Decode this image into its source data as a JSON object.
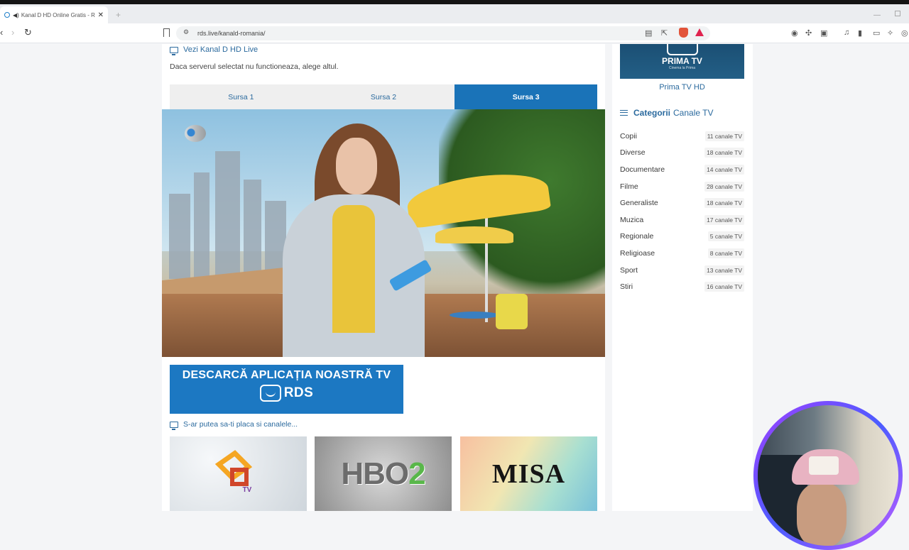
{
  "browser": {
    "tab_title": "Kanal D HD Online Gratis - RDS",
    "url": "rds.live/kanald-romania/",
    "new_tab_symbol": "+",
    "close_symbol": "✕"
  },
  "main": {
    "live_title": "Vezi Kanal D HD Live",
    "notice": "Daca serverul selectat nu functioneaza, alege altul.",
    "sources": [
      "Sursa 1",
      "Sursa 2",
      "Sursa 3"
    ],
    "active_source_index": 2,
    "app_banner": {
      "line1": "DESCARCĂ APLICAȚIA NOASTRĂ TV",
      "brand": "RDS"
    },
    "suggest_title": "S-ar putea sa-ti placa si canalele...",
    "suggested_channels": [
      {
        "name": "UTV",
        "logo_text": "TV"
      },
      {
        "name": "HBO 2",
        "logo_text_a": "HBO",
        "logo_text_b": "2"
      },
      {
        "name": "MISA",
        "logo_text": "MISA"
      }
    ]
  },
  "sidebar": {
    "featured": {
      "logo_name": "PRIMA TV",
      "logo_sub": "Cinema la Prima",
      "caption": "Prima TV HD"
    },
    "categories_title_pre": "Categorii",
    "categories_title": "Canale TV",
    "categories": [
      {
        "name": "Copii",
        "count": "11 canale TV"
      },
      {
        "name": "Diverse",
        "count": "18 canale TV"
      },
      {
        "name": "Documentare",
        "count": "14 canale TV"
      },
      {
        "name": "Filme",
        "count": "28 canale TV"
      },
      {
        "name": "Generaliste",
        "count": "18 canale TV"
      },
      {
        "name": "Muzica",
        "count": "17 canale TV"
      },
      {
        "name": "Regionale",
        "count": "5 canale TV"
      },
      {
        "name": "Religioase",
        "count": "8 canale TV"
      },
      {
        "name": "Sport",
        "count": "13 canale TV"
      },
      {
        "name": "Stiri",
        "count": "16 canale TV"
      }
    ]
  },
  "colors": {
    "accent": "#1a73b8",
    "link": "#2b6a9e",
    "banner": "#1c78c2"
  }
}
